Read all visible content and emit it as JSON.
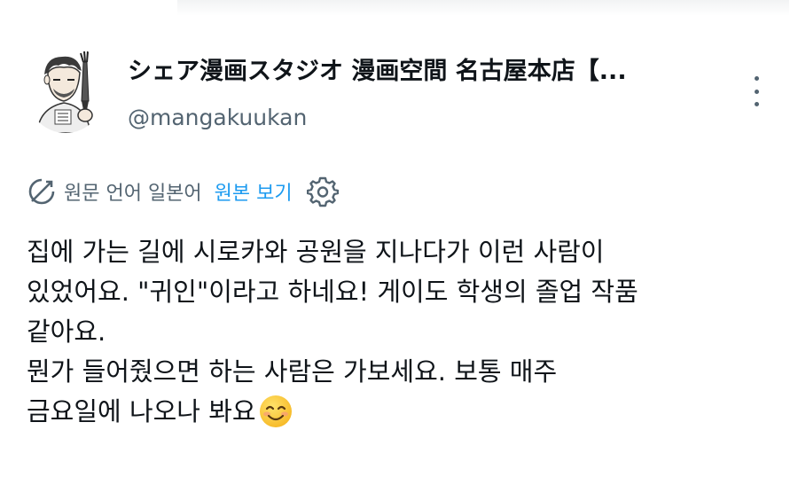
{
  "author": {
    "display_name": "シェア漫画スタジオ 漫画空間 名古屋本店【...",
    "handle": "@mangakuukan"
  },
  "translation_bar": {
    "original_language_label": "원문 언어 일본어",
    "view_original_link": "원본 보기"
  },
  "tweet": {
    "lines": [
      "집에 가는 길에 시로카와 공원을 지나다가 이런 사람이",
      "있었어요. \"귀인\"이라고 하네요! 게이도 학생의 졸업 작품",
      "같아요.",
      "뭔가 들어줬으면 하는 사람은 가보세요. 보통 매주",
      "금요일에 나오나 봐요"
    ],
    "emoji": "smiling-face-emoji"
  },
  "colors": {
    "text": "#0f1419",
    "secondary": "#536471",
    "link": "#1d9bf0"
  },
  "icons": [
    "avatar-illustration",
    "translate-icon",
    "gear-icon",
    "more-options-icon",
    "smiling-face-emoji"
  ]
}
